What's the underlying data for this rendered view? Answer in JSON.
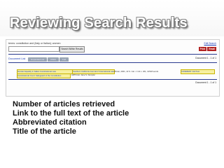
{
  "slide": {
    "title": "Reviewing Search Results"
  },
  "screenshot": {
    "query_text": "terms: constitution and (Italy or Italian); women",
    "search_input_value": "",
    "search_button_label": "Search Within Results",
    "edit_search_label": "Edit Search",
    "print_label": "Print",
    "email_label": "Email",
    "tabs": {
      "document_list": "Document List",
      "tab2": "Expanded List",
      "tab3": "KWIC",
      "tab4": "Full"
    },
    "document_count_top": "Document 1 - 1 of 1",
    "document_count_bottom": "Document 1 - 1 of 1",
    "result": {
      "title_link": "Gender Equality in Italian Constitutional Law",
      "subtitle_link": "Constitutional Court: Safeguard of the Constitution",
      "journal_link": "Southern California Journal of International Law",
      "citation": "Winter, 2001, 10 S. Cal. J. Intl L. 261, 12518 words",
      "author": "ARTICLE: Jane S. Dempler",
      "full_text_link": "COMMENT: Full Text"
    }
  },
  "bullets": [
    {
      "glyph": "",
      "text": "Number of articles retrieved"
    },
    {
      "glyph": "",
      "text": "Link to the full text of the article"
    },
    {
      "glyph": "",
      "text": "Abbreviated citation"
    },
    {
      "glyph": "",
      "text": "Title of the article"
    }
  ]
}
